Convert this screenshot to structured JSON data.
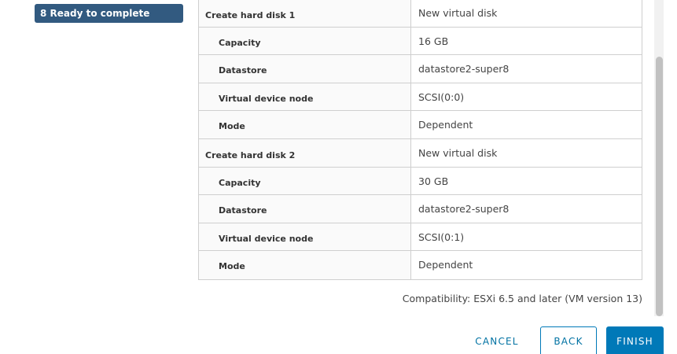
{
  "wizard": {
    "current_step": "8 Ready to complete"
  },
  "summary": {
    "rows": [
      {
        "label": "Create hard disk 1",
        "value": "New virtual disk"
      },
      {
        "label": "Capacity",
        "value": "16 GB"
      },
      {
        "label": "Datastore",
        "value": "datastore2-super8"
      },
      {
        "label": "Virtual device node",
        "value": "SCSI(0:0)"
      },
      {
        "label": "Mode",
        "value": "Dependent"
      },
      {
        "label": "Create hard disk 2",
        "value": "New virtual disk"
      },
      {
        "label": "Capacity",
        "value": "30 GB"
      },
      {
        "label": "Datastore",
        "value": "datastore2-super8"
      },
      {
        "label": "Virtual device node",
        "value": "SCSI(0:1)"
      },
      {
        "label": "Mode",
        "value": "Dependent"
      }
    ],
    "compatibility": "Compatibility: ESXi 6.5 and later (VM version 13)"
  },
  "footer": {
    "cancel_label": "CANCEL",
    "back_label": "BACK",
    "finish_label": "FINISH"
  },
  "colors": {
    "step_active_bg": "#325a80",
    "primary": "#0079b8",
    "link": "#0072a3"
  }
}
